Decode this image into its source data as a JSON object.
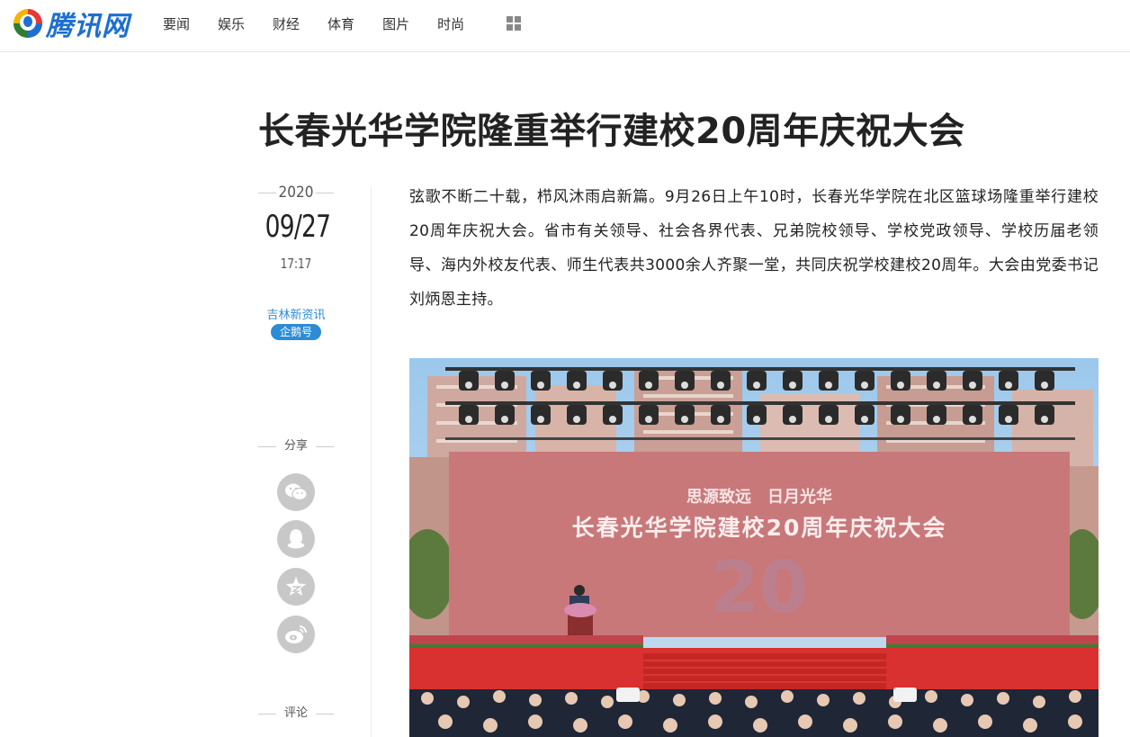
{
  "header": {
    "logo_text": "腾讯网",
    "nav": [
      "要闻",
      "娱乐",
      "财经",
      "体育",
      "图片",
      "时尚"
    ]
  },
  "article": {
    "title": "长春光华学院隆重举行建校20周年庆祝大会",
    "year": "2020",
    "date": "09/27",
    "time": "17:17",
    "source": "吉林新资讯",
    "badge": "企鹅号",
    "share_label": "分享",
    "comment_label": "评论",
    "body": "弦歌不断二十载，栉风沐雨启新篇。9月26日上午10时，长春光华学院在北区篮球场隆重举行建校20周年庆祝大会。省市有关领导、社会各界代表、兄弟院校领导、学校党政领导、学校历届老领导、海内外校友代表、师生代表共3000余人齐聚一堂，共同庆祝学校建校20周年。大会由党委书记刘炳恩主持。"
  },
  "photo": {
    "banner_line1": "思源致远　日月光华",
    "banner_line2": "长春光华学院建校20周年庆祝大会",
    "banner_number": "20"
  },
  "share_icons": [
    "wechat-icon",
    "qq-icon",
    "qzone-icon",
    "weibo-icon"
  ]
}
